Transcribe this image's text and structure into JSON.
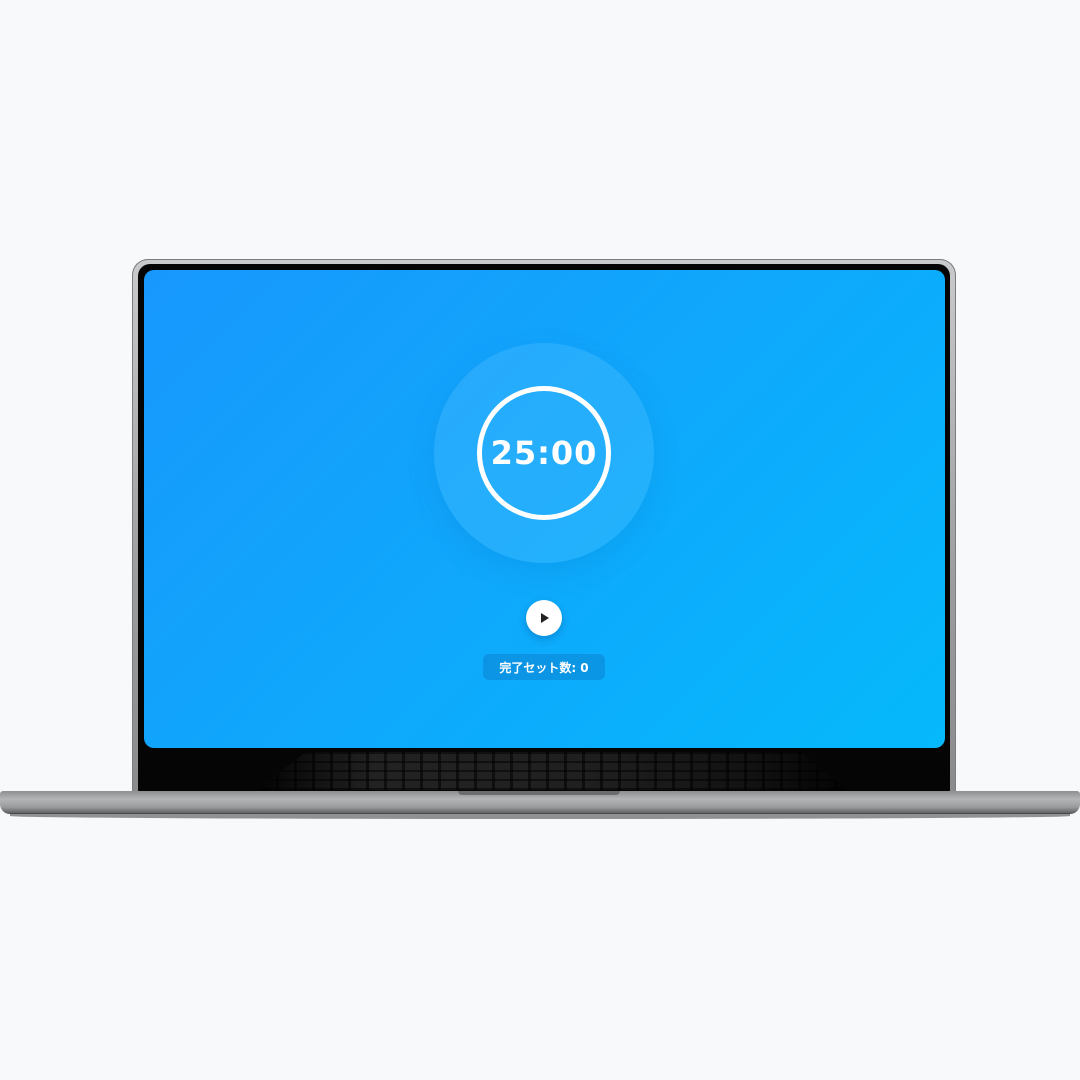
{
  "timer": {
    "display": "25:00"
  },
  "controls": {
    "play_icon": "play-icon"
  },
  "stats": {
    "completed_sets": "完了セット数: 0"
  },
  "colors": {
    "screen_gradient_start": "#1898fd",
    "screen_gradient_end": "#05b9fb",
    "ring": "#ffffff",
    "page_background": "#f7f9fb"
  }
}
